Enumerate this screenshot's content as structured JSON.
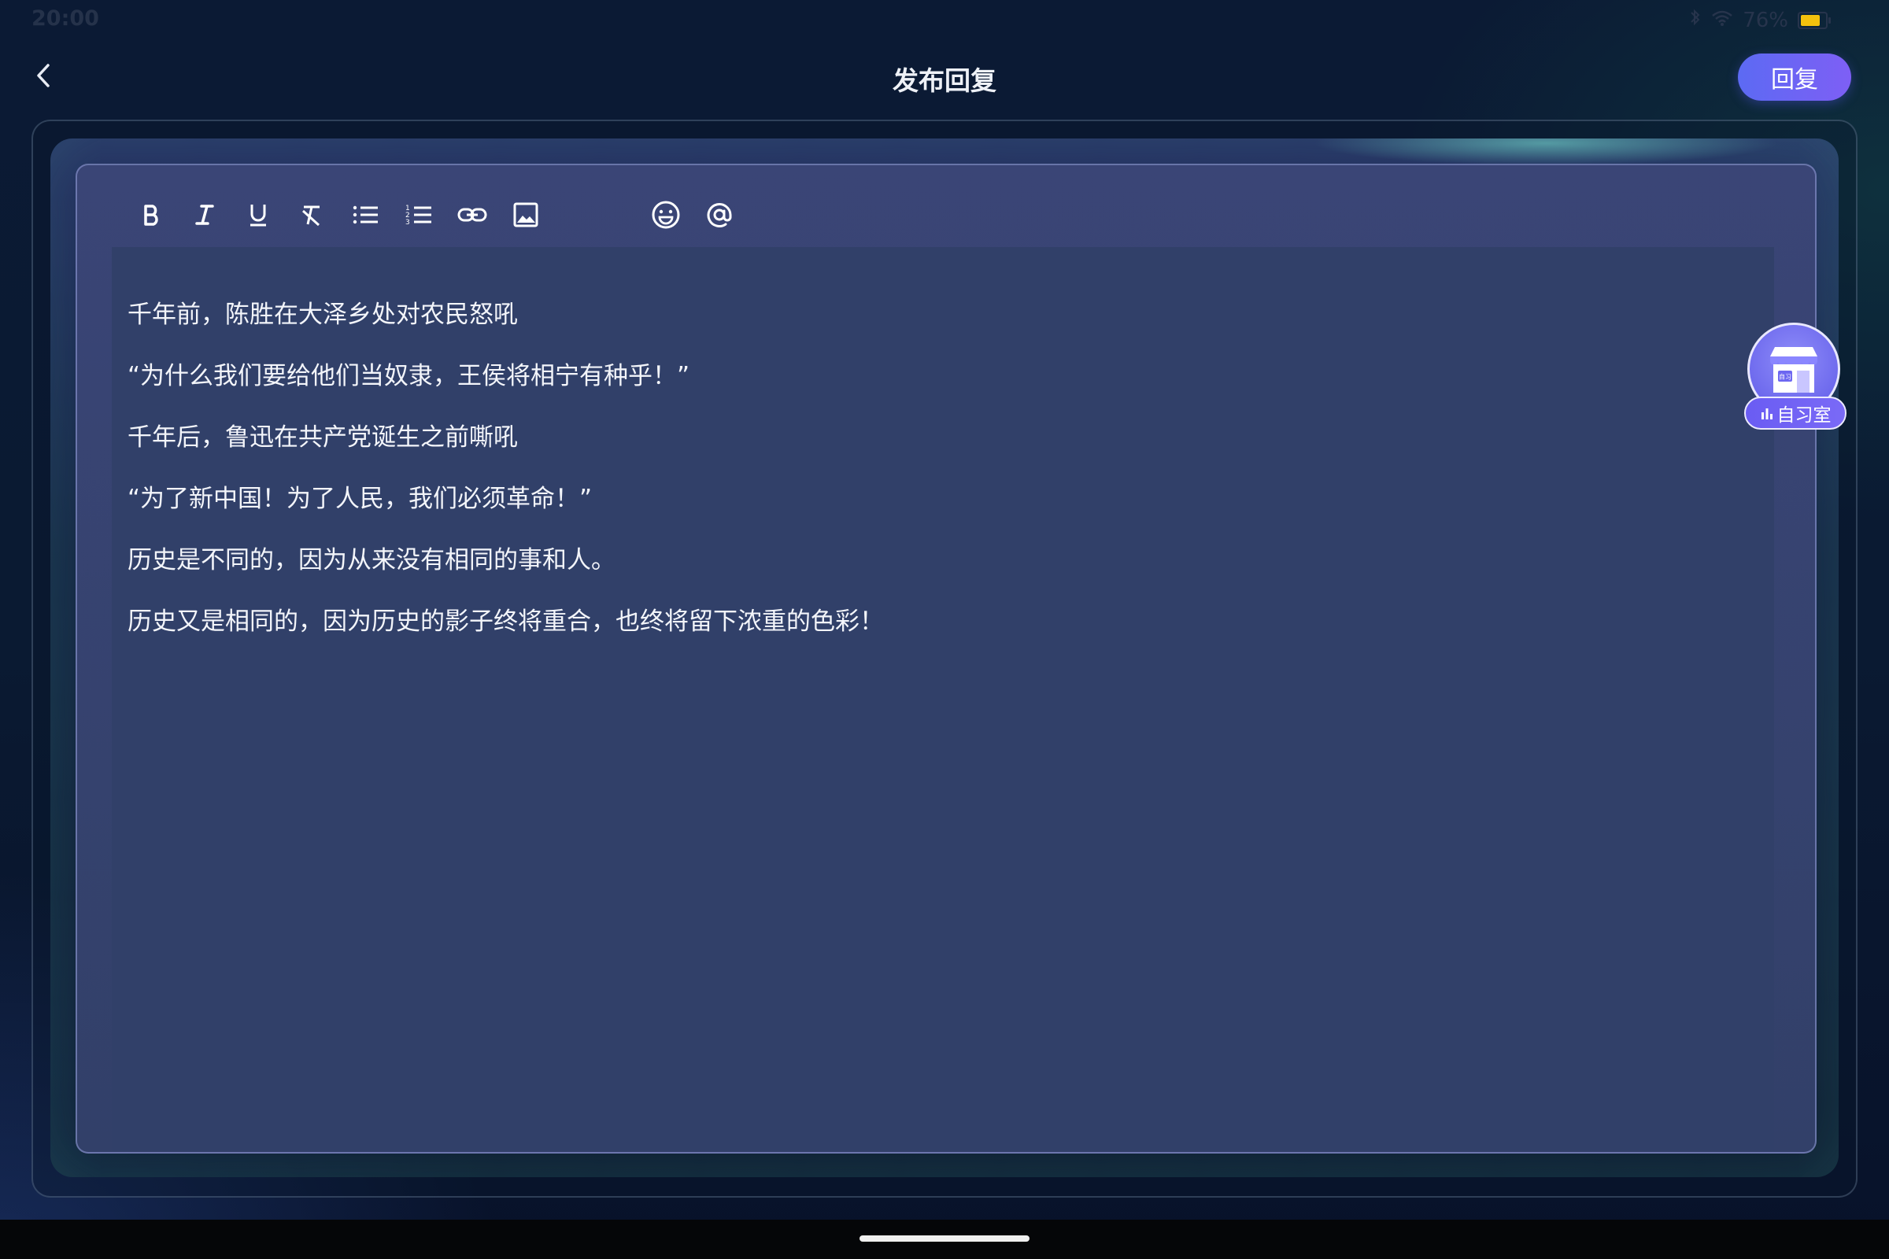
{
  "status_bar": {
    "time": "20:00",
    "battery_percent": "76%",
    "icons": [
      "bluetooth-icon",
      "wifi-icon",
      "battery-icon"
    ]
  },
  "header": {
    "title": "发布回复",
    "reply_label": "回复",
    "back_icon": "chevron-left-icon"
  },
  "toolbar": {
    "buttons": [
      "bold-icon",
      "italic-icon",
      "underline-icon",
      "clear-format-icon",
      "bullet-list-icon",
      "numbered-list-icon",
      "link-icon",
      "image-icon",
      "emoji-icon",
      "mention-icon"
    ]
  },
  "editor": {
    "paragraphs": [
      "千年前，陈胜在大泽乡处对农民怒吼",
      "“为什么我们要给他们当奴隶，王侯将相宁有种乎！”",
      "千年后，鲁迅在共产党诞生之前嘶吼",
      "“为了新中国！为了人民，我们必须革命！”",
      "历史是不同的，因为从来没有相同的事和人。",
      "历史又是相同的，因为历史的影子终将重合，也终将留下浓重的色彩！"
    ]
  },
  "study_room": {
    "label": "自习室",
    "sign_text": "自习",
    "icon": "store-icon"
  },
  "colors": {
    "accent": "#6a63f4",
    "editor_bg": "#314069"
  }
}
